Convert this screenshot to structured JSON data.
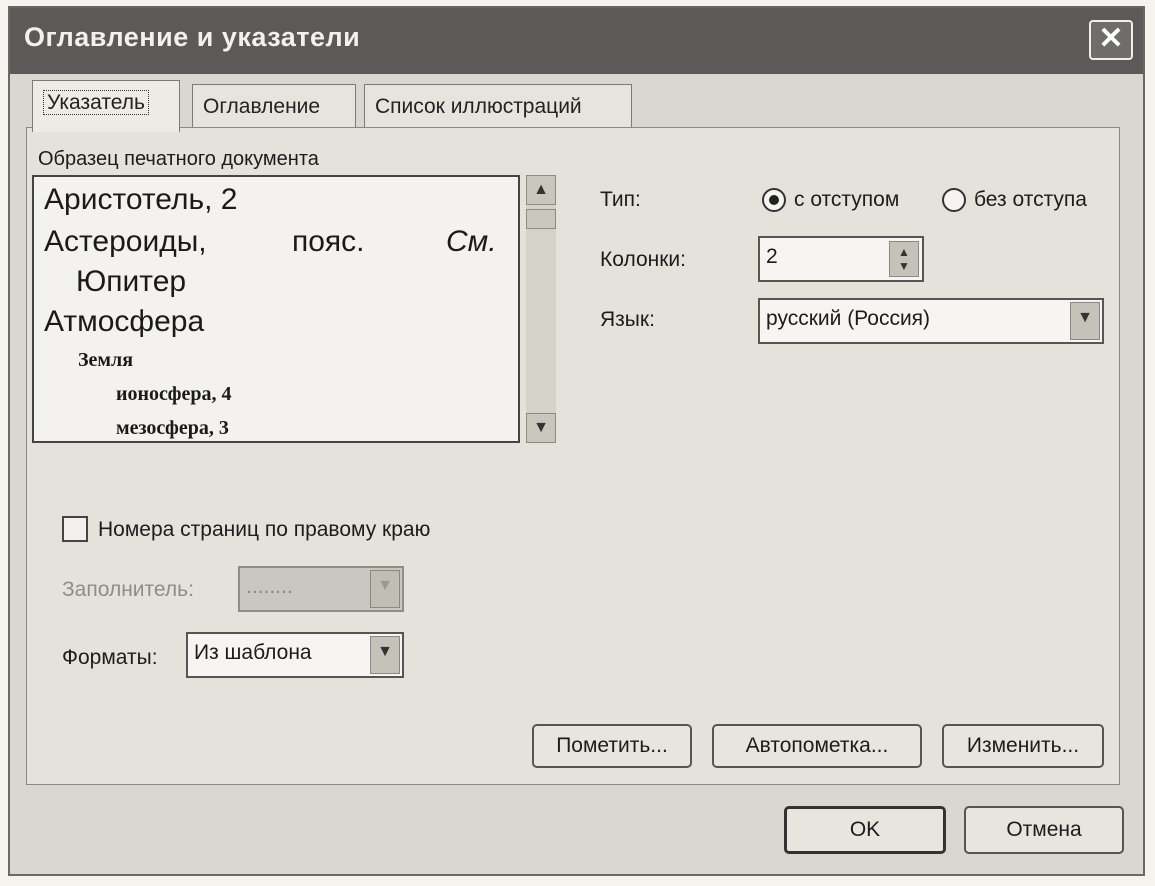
{
  "window": {
    "title": "Оглавление и указатели",
    "close_icon": "close-icon"
  },
  "tabs": [
    {
      "label": "Указатель",
      "active": true
    },
    {
      "label": "Оглавление",
      "active": false
    },
    {
      "label": "Список иллюстраций",
      "active": false
    }
  ],
  "preview": {
    "label": "Образец печатного документа",
    "lines": {
      "l1": "Аристотель, 2",
      "l2a": "Астероиды,",
      "l2b": "пояс.",
      "l2c": "См.",
      "l3": "Юпитер",
      "l4": "Атмосфера",
      "l5": "Земля",
      "l6": "ионосфера, 4",
      "l7": "мезосфера, 3"
    }
  },
  "type": {
    "label": "Тип:",
    "option_indent": "с отступом",
    "option_no_indent": "без отступа",
    "selected": "с отступом"
  },
  "columns": {
    "label": "Колонки:",
    "value": "2"
  },
  "language": {
    "label": "Язык:",
    "value": "русский (Россия)"
  },
  "right_align": {
    "label": "Номера страниц по правому краю",
    "checked": false
  },
  "leader": {
    "label": "Заполнитель:",
    "value": "........",
    "enabled": false
  },
  "formats": {
    "label": "Форматы:",
    "value": "Из шаблона"
  },
  "buttons": {
    "mark": "Пометить...",
    "automark": "Автопометка...",
    "modify": "Изменить...",
    "ok": "OK",
    "cancel": "Отмена"
  }
}
